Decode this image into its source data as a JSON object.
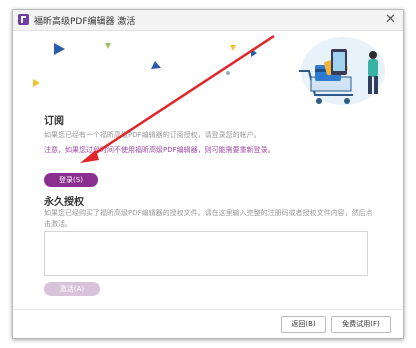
{
  "window": {
    "title": "福昕高级PDF编辑器 激活",
    "close_glyph": "✕"
  },
  "subscription": {
    "heading": "订阅",
    "description": "如果您已经有一个福昕高级PDF编辑器的订阅授权，请登录您的帐户。",
    "warning": "注意，如果您过段时间不使用福昕高级PDF编辑器，则可能需要重新登录。",
    "login_label": "登录(S)"
  },
  "perpetual": {
    "heading": "永久授权",
    "description": "如果您已经购买了福昕高级PDF编辑器的授权文件。请在这里输入完整的注册码或者授权文件内容，然后点击激活。",
    "submit_label": "激活(A)",
    "code_value": ""
  },
  "footer": {
    "back_label": "返回(B)",
    "trial_label": "免费试用(F)"
  },
  "colors": {
    "accent": "#8a2f8f",
    "disabled": "#d9c3da",
    "annotation_arrow": "#e0262b",
    "warning_text": "#a24aa8"
  }
}
